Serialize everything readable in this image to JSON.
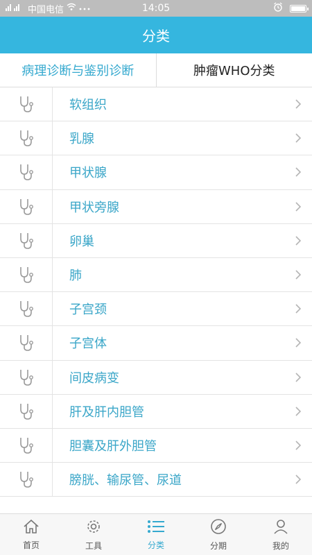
{
  "status_bar": {
    "left_text": "中国电信",
    "time": "14:05"
  },
  "header": {
    "title": "分类"
  },
  "tabs": [
    {
      "label": "病理诊断与鉴别诊断",
      "active": true
    },
    {
      "label": "肿瘤WHO分类",
      "active": false
    }
  ],
  "list": {
    "items": [
      {
        "label": "软组织",
        "icon": "stethoscope-icon"
      },
      {
        "label": "乳腺",
        "icon": "stethoscope-icon"
      },
      {
        "label": "甲状腺",
        "icon": "stethoscope-icon"
      },
      {
        "label": "甲状旁腺",
        "icon": "stethoscope-icon"
      },
      {
        "label": "卵巢",
        "icon": "stethoscope-icon"
      },
      {
        "label": "肺",
        "icon": "stethoscope-icon"
      },
      {
        "label": "子宫颈",
        "icon": "stethoscope-icon"
      },
      {
        "label": "子宫体",
        "icon": "stethoscope-icon"
      },
      {
        "label": "间皮病变",
        "icon": "stethoscope-icon"
      },
      {
        "label": "肝及肝内胆管",
        "icon": "stethoscope-icon"
      },
      {
        "label": "胆囊及肝外胆管",
        "icon": "stethoscope-icon"
      },
      {
        "label": "膀胱、输尿管、尿道",
        "icon": "stethoscope-icon"
      }
    ]
  },
  "bottom_nav": {
    "items": [
      {
        "label": "首页",
        "icon": "home-icon",
        "active": false
      },
      {
        "label": "工具",
        "icon": "gear-icon",
        "active": false
      },
      {
        "label": "分类",
        "icon": "list-icon",
        "active": true
      },
      {
        "label": "分期",
        "icon": "compass-icon",
        "active": false
      },
      {
        "label": "我的",
        "icon": "user-icon",
        "active": false
      }
    ]
  },
  "colors": {
    "accent": "#35b6df",
    "list_text": "#3aa6c8",
    "nav_inactive": "#555555"
  }
}
